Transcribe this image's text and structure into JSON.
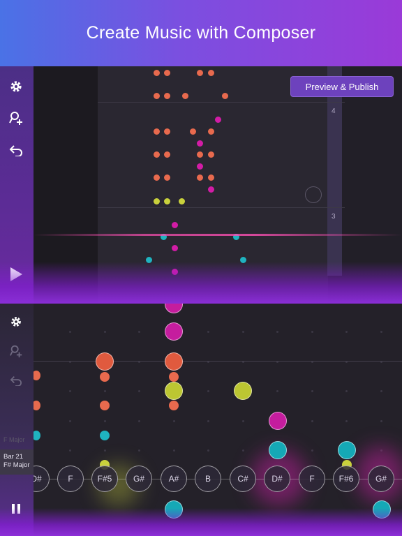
{
  "banner": {
    "title": "Create Music with Composer"
  },
  "top_panel": {
    "publish_button": "Preview & Publish",
    "measures": [
      {
        "label": "4"
      },
      {
        "label": "3"
      }
    ],
    "icons": [
      "gear-icon",
      "add-user-icon",
      "undo-icon",
      "play-icon"
    ]
  },
  "bottom_panel": {
    "faint_key_label": "F Major",
    "bar_info": {
      "bar": "Bar 21",
      "key": "F# Major"
    },
    "keys": [
      "D#",
      "F",
      "F#5",
      "G#",
      "A#",
      "B",
      "C#",
      "D#",
      "F",
      "F#6",
      "G#"
    ],
    "icons": [
      "gear-icon",
      "add-user-icon",
      "undo-icon",
      "pause-icon"
    ]
  },
  "colors": {
    "note_orange": "#e86a4e",
    "note_magenta": "#d21ca6",
    "note_lime": "#c9d13c",
    "note_teal": "#1fb3c0",
    "accent_purple": "#6d42bd"
  }
}
